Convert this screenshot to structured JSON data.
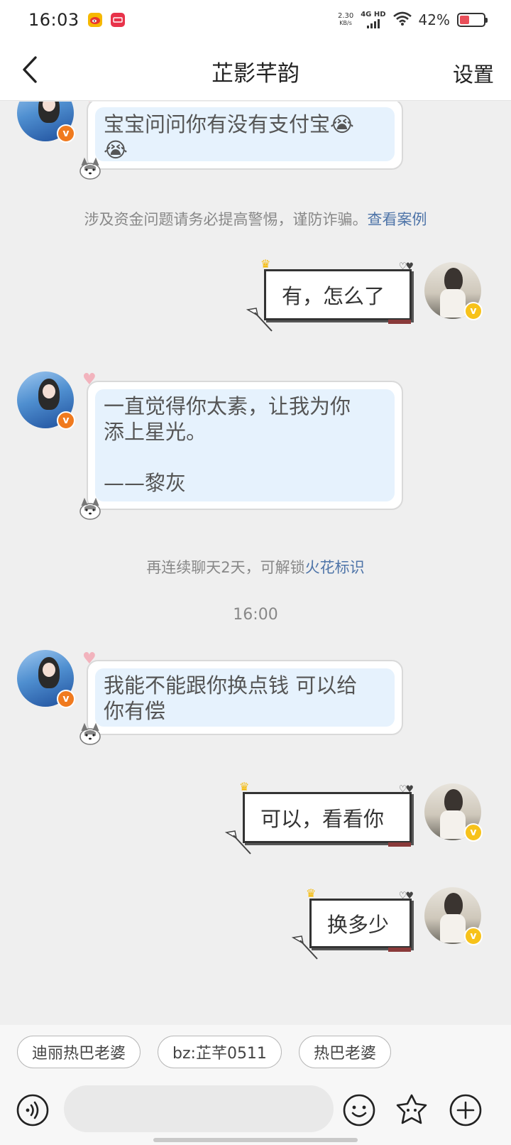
{
  "status_bar": {
    "time": "16:03",
    "net_speed_value": "2.30",
    "net_speed_unit": "KB/s",
    "network_type": "4G HD",
    "battery_percent": "42%",
    "battery_level": 0.42
  },
  "header": {
    "title": "芷影芊韵",
    "settings_label": "设置"
  },
  "messages": [
    {
      "side": "left",
      "text": "宝宝问问你有没有支付宝😭\n😭"
    },
    {
      "side": "right",
      "text": "有，怎么了"
    },
    {
      "side": "left",
      "text": "一直觉得你太素，让我为你\n添上星光。\n\n——黎灰"
    },
    {
      "side": "left",
      "text": "我能不能跟你换点钱 可以给\n你有偿"
    },
    {
      "side": "right",
      "text": "可以，看看你"
    },
    {
      "side": "right",
      "text": "换多少"
    }
  ],
  "system_notes": {
    "fraud_warning": "涉及资金问题请务必提高警惕，谨防诈骗。",
    "fraud_link": "查看案例",
    "streak_text": "再连续聊天2天，可解锁",
    "streak_link": "火花标识",
    "timestamp": "16:00"
  },
  "quick_replies": [
    "迪丽热巴老婆",
    "bz:芷芊0511",
    "热巴老婆"
  ],
  "input": {
    "placeholder": ""
  },
  "icons": {
    "back": "chevron-left-icon",
    "voice": "voice-icon",
    "emoji": "emoji-icon",
    "sticker": "sticker-icon",
    "plus": "plus-icon"
  },
  "colors": {
    "bubble_left_fill": "#e6f2fd",
    "link": "#4e74a8",
    "verified_left": "#f07a1e",
    "verified_right": "#f7c21a"
  }
}
